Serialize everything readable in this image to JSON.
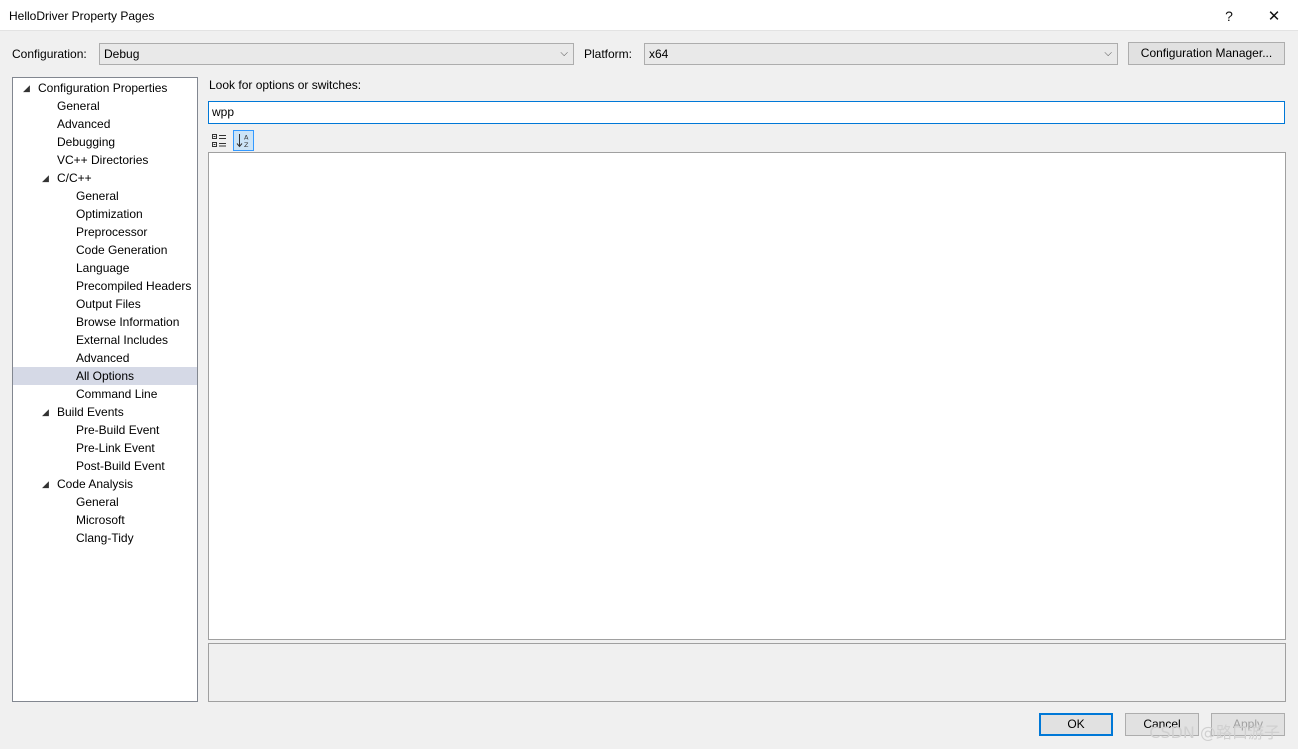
{
  "window": {
    "title": "HelloDriver Property Pages",
    "help_glyph": "?",
    "close_glyph": "✕"
  },
  "config_bar": {
    "configuration_label": "Configuration:",
    "configuration_value": "Debug",
    "platform_label": "Platform:",
    "platform_value": "x64",
    "manager_button": "Configuration Manager..."
  },
  "tree": [
    {
      "label": "Configuration Properties",
      "expander": "◢",
      "level": 0
    },
    {
      "label": "General",
      "level": 1
    },
    {
      "label": "Advanced",
      "level": 1
    },
    {
      "label": "Debugging",
      "level": 1
    },
    {
      "label": "VC++ Directories",
      "level": 1
    },
    {
      "label": "C/C++",
      "expander": "◢",
      "level": 1
    },
    {
      "label": "General",
      "level": 2
    },
    {
      "label": "Optimization",
      "level": 2
    },
    {
      "label": "Preprocessor",
      "level": 2
    },
    {
      "label": "Code Generation",
      "level": 2
    },
    {
      "label": "Language",
      "level": 2
    },
    {
      "label": "Precompiled Headers",
      "level": 2
    },
    {
      "label": "Output Files",
      "level": 2
    },
    {
      "label": "Browse Information",
      "level": 2
    },
    {
      "label": "External Includes",
      "level": 2
    },
    {
      "label": "Advanced",
      "level": 2
    },
    {
      "label": "All Options",
      "level": 2,
      "selected": true
    },
    {
      "label": "Command Line",
      "level": 2
    },
    {
      "label": "Build Events",
      "expander": "◢",
      "level": 1
    },
    {
      "label": "Pre-Build Event",
      "level": 2
    },
    {
      "label": "Pre-Link Event",
      "level": 2
    },
    {
      "label": "Post-Build Event",
      "level": 2
    },
    {
      "label": "Code Analysis",
      "expander": "◢",
      "level": 1
    },
    {
      "label": "General",
      "level": 2
    },
    {
      "label": "Microsoft",
      "level": 2
    },
    {
      "label": "Clang-Tidy",
      "level": 2
    }
  ],
  "search": {
    "label": "Look for options or switches:",
    "value": "wpp"
  },
  "toolbar": {
    "categorized_icon": "categorized-view-icon",
    "alphabetical_icon": "sort-alphabetical-icon"
  },
  "footer": {
    "ok": "OK",
    "cancel": "Cancel",
    "apply": "Apply"
  },
  "watermark": "CSDN @路口游子",
  "colors": {
    "accent": "#0078d7",
    "selection": "#d5d9e6"
  }
}
